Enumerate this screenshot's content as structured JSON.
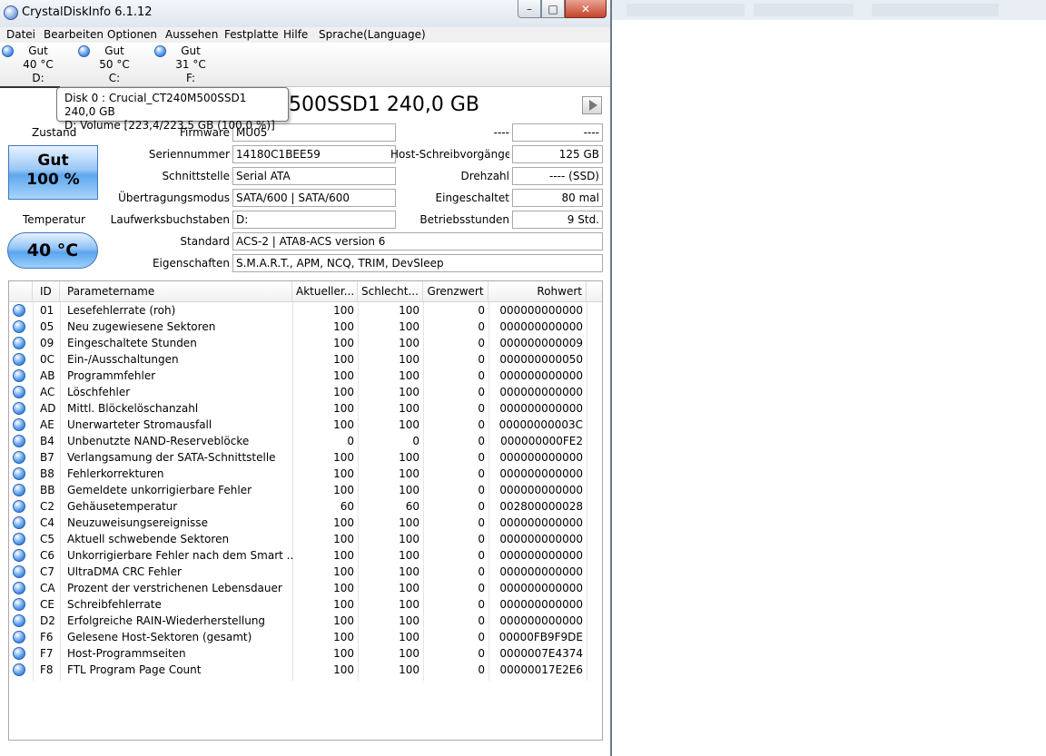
{
  "window": {
    "title": "CrystalDiskInfo 6.1.12",
    "min_glyph": "–",
    "max_glyph": "□",
    "close_glyph": "✕"
  },
  "menu": [
    "Datei",
    "Bearbeiten",
    "Optionen",
    "Aussehen",
    "Festplatte",
    "Hilfe",
    "Sprache(Language)"
  ],
  "disks": [
    {
      "status": "Gut",
      "temp": "40 °C",
      "drive": "D:"
    },
    {
      "status": "Gut",
      "temp": "50 °C",
      "drive": "C:"
    },
    {
      "status": "Gut",
      "temp": "31 °C",
      "drive": "F:"
    }
  ],
  "tooltip": {
    "line1": "Disk 0 : Crucial_CT240M500SSD1 240,0 GB",
    "line2": "D: Volume [223,4/223,5 GB (100,0 %)]"
  },
  "model_title": "500SSD1 240,0 GB",
  "health": {
    "label": "Zustand",
    "status": "Gut",
    "percent": "100 %"
  },
  "temperature": {
    "label": "Temperatur",
    "value": "40 °C"
  },
  "info": {
    "firmware": {
      "label": "Firmware",
      "value": "MU05"
    },
    "serial": {
      "label": "Seriennummer",
      "value": "14180C1BEE59"
    },
    "interface": {
      "label": "Schnittstelle",
      "value": "Serial ATA"
    },
    "transfer": {
      "label": "Übertragungsmodus",
      "value": "SATA/600 | SATA/600"
    },
    "letters": {
      "label": "Laufwerksbuchstaben",
      "value": "D:"
    },
    "standard": {
      "label": "Standard",
      "value": "ACS-2 | ATA8-ACS version 6"
    },
    "features": {
      "label": "Eigenschaften",
      "value": "S.M.A.R.T., APM, NCQ, TRIM, DevSleep"
    },
    "right_top": {
      "label": "----",
      "value": "----"
    },
    "host_writes": {
      "label": "Host-Schreibvorgänge (",
      "value": "125 GB"
    },
    "rotation": {
      "label": "Drehzahl",
      "value": "---- (SSD)"
    },
    "power_on_count": {
      "label": "Eingeschaltet",
      "value": "80 mal"
    },
    "power_on_hours": {
      "label": "Betriebsstunden",
      "value": "9 Std."
    }
  },
  "table": {
    "columns": [
      "ID",
      "Parametername",
      "Aktueller...",
      "Schlecht...",
      "Grenzwert",
      "Rohwert"
    ],
    "rows": [
      [
        "01",
        "Lesefehlerrate (roh)",
        "100",
        "100",
        "0",
        "000000000000"
      ],
      [
        "05",
        "Neu zugewiesene Sektoren",
        "100",
        "100",
        "0",
        "000000000000"
      ],
      [
        "09",
        "Eingeschaltete Stunden",
        "100",
        "100",
        "0",
        "000000000009"
      ],
      [
        "0C",
        "Ein-/Ausschaltungen",
        "100",
        "100",
        "0",
        "000000000050"
      ],
      [
        "AB",
        "Programmfehler",
        "100",
        "100",
        "0",
        "000000000000"
      ],
      [
        "AC",
        "Löschfehler",
        "100",
        "100",
        "0",
        "000000000000"
      ],
      [
        "AD",
        "Mittl. Blöckelöschanzahl",
        "100",
        "100",
        "0",
        "000000000000"
      ],
      [
        "AE",
        "Unerwarteter Stromausfall",
        "100",
        "100",
        "0",
        "00000000003C"
      ],
      [
        "B4",
        "Unbenutzte NAND-Reserveblöcke",
        "0",
        "0",
        "0",
        "000000000FE2"
      ],
      [
        "B7",
        "Verlangsamung der SATA-Schnittstelle",
        "100",
        "100",
        "0",
        "000000000000"
      ],
      [
        "B8",
        "Fehlerkorrekturen",
        "100",
        "100",
        "0",
        "000000000000"
      ],
      [
        "BB",
        "Gemeldete unkorrigierbare Fehler",
        "100",
        "100",
        "0",
        "000000000000"
      ],
      [
        "C2",
        "Gehäusetemperatur",
        "60",
        "60",
        "0",
        "002800000028"
      ],
      [
        "C4",
        "Neuzuweisungsereignisse",
        "100",
        "100",
        "0",
        "000000000000"
      ],
      [
        "C5",
        "Aktuell schwebende Sektoren",
        "100",
        "100",
        "0",
        "000000000000"
      ],
      [
        "C6",
        "Unkorrigierbare Fehler nach dem Smart ...",
        "100",
        "100",
        "0",
        "000000000000"
      ],
      [
        "C7",
        "UltraDMA CRC Fehler",
        "100",
        "100",
        "0",
        "000000000000"
      ],
      [
        "CA",
        "Prozent der verstrichenen Lebensdauer",
        "100",
        "100",
        "0",
        "000000000000"
      ],
      [
        "CE",
        "Schreibfehlerrate",
        "100",
        "100",
        "0",
        "000000000000"
      ],
      [
        "D2",
        "Erfolgreiche RAIN-Wiederherstellung",
        "100",
        "100",
        "0",
        "000000000000"
      ],
      [
        "F6",
        "Gelesene Host-Sektoren (gesamt)",
        "100",
        "100",
        "0",
        "00000FB9F9DE"
      ],
      [
        "F7",
        "Host-Programmseiten",
        "100",
        "100",
        "0",
        "0000007E4374"
      ],
      [
        "F8",
        "FTL Program Page Count",
        "100",
        "100",
        "0",
        "00000017E2E6"
      ]
    ]
  }
}
